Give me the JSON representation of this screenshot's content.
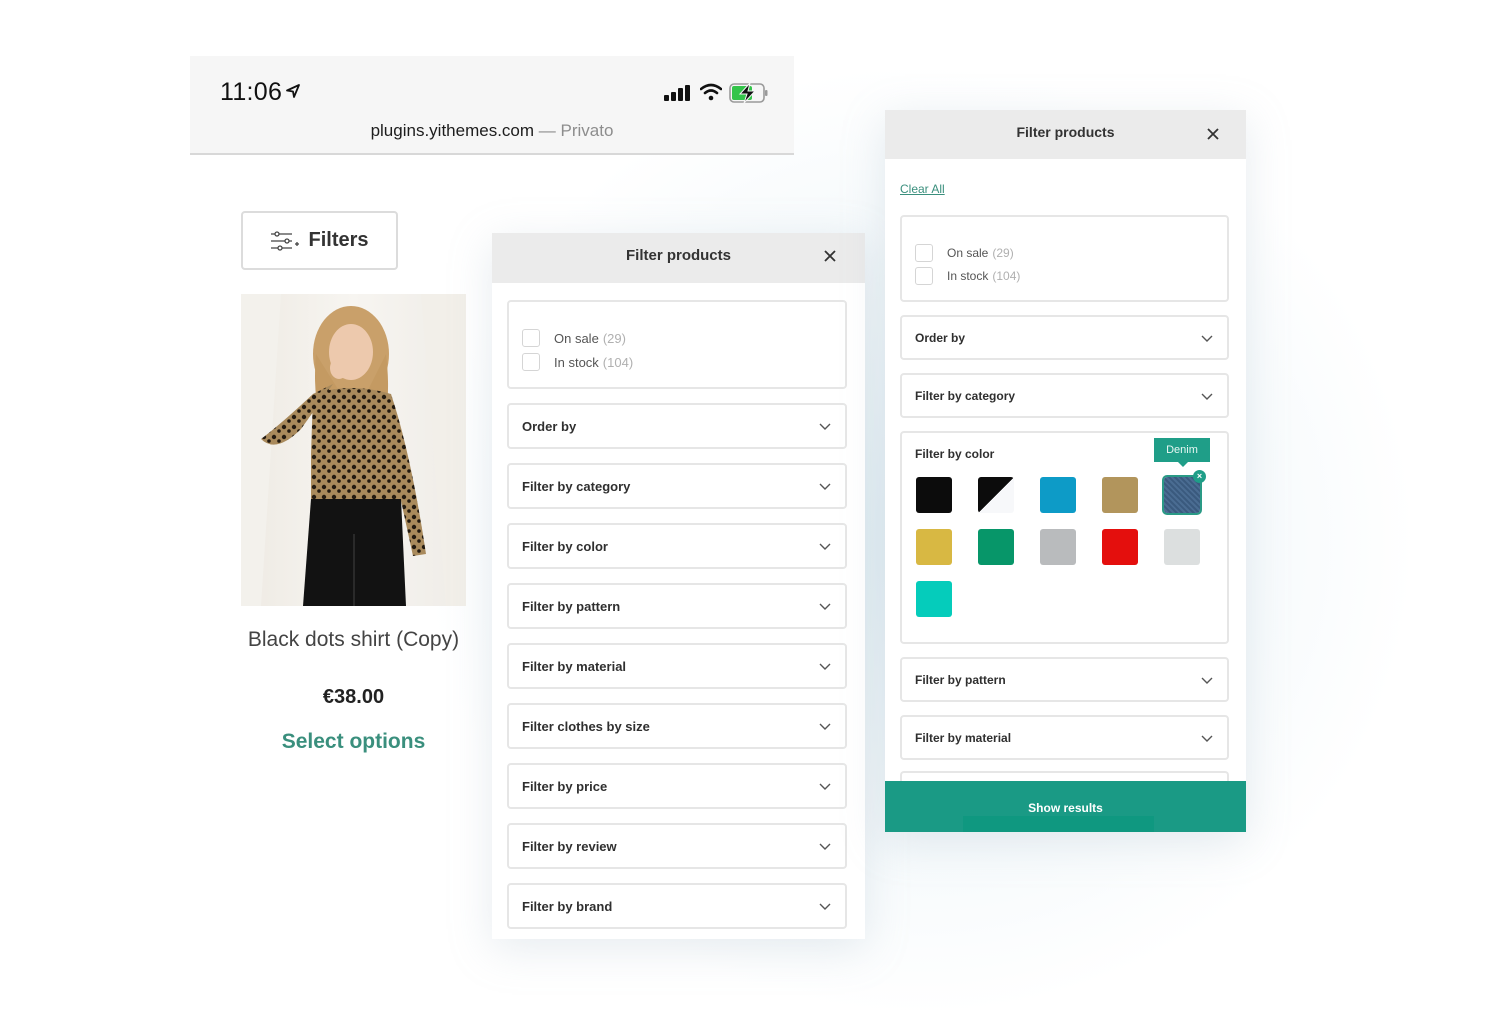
{
  "statusbar": {
    "time": "11:06",
    "url_host": "plugins.yithemes.com",
    "url_separator": " — ",
    "url_mode": "Privato",
    "icons": [
      "location-arrow-icon",
      "signal-icon",
      "wifi-icon",
      "battery-charging-icon"
    ]
  },
  "filters_button": {
    "label": "Filters",
    "icon": "sliders-icon"
  },
  "product": {
    "title": "Black dots shirt (Copy)",
    "price": "€38.00",
    "cta": "Select options"
  },
  "panel_mid": {
    "title": "Filter products",
    "close_icon": "close-icon",
    "checks": [
      {
        "label": "On sale",
        "count": "(29)",
        "checked": false
      },
      {
        "label": "In stock",
        "count": "(104)",
        "checked": false
      }
    ],
    "accordions": [
      "Order by",
      "Filter by category",
      "Filter by color",
      "Filter by pattern",
      "Filter by material",
      "Filter clothes by size",
      "Filter by price",
      "Filter by review",
      "Filter by brand"
    ]
  },
  "panel_right": {
    "title": "Filter products",
    "close_icon": "close-icon",
    "clear_all": "Clear All",
    "checks": [
      {
        "label": "On sale",
        "count": "(29)",
        "checked": false
      },
      {
        "label": "In stock",
        "count": "(104)",
        "checked": false
      }
    ],
    "accordions_top": [
      "Order by",
      "Filter by category"
    ],
    "color_filter": {
      "title": "Filter by color",
      "tooltip": "Denim",
      "swatches": [
        {
          "name": "black",
          "color": "#0c0c0c"
        },
        {
          "name": "black-white",
          "color": "split:#0c0c0c/#f7f8fa"
        },
        {
          "name": "blue",
          "color": "#0d9bc7"
        },
        {
          "name": "beige",
          "color": "#b2955c"
        },
        {
          "name": "denim",
          "color": "#3d5e82",
          "selected": true
        },
        {
          "name": "yellow",
          "color": "#d8b843"
        },
        {
          "name": "green",
          "color": "#079669"
        },
        {
          "name": "grey",
          "color": "#b9bbbd"
        },
        {
          "name": "red",
          "color": "#e40f0d"
        },
        {
          "name": "light-grey",
          "color": "#dcdfdf"
        },
        {
          "name": "turquoise",
          "color": "#05ccbb"
        }
      ]
    },
    "accordions_bottom": [
      "Filter by pattern",
      "Filter by material"
    ],
    "show_results": "Show results"
  },
  "colors": {
    "accent": "#1a9a85",
    "link": "#3a8f7d"
  }
}
